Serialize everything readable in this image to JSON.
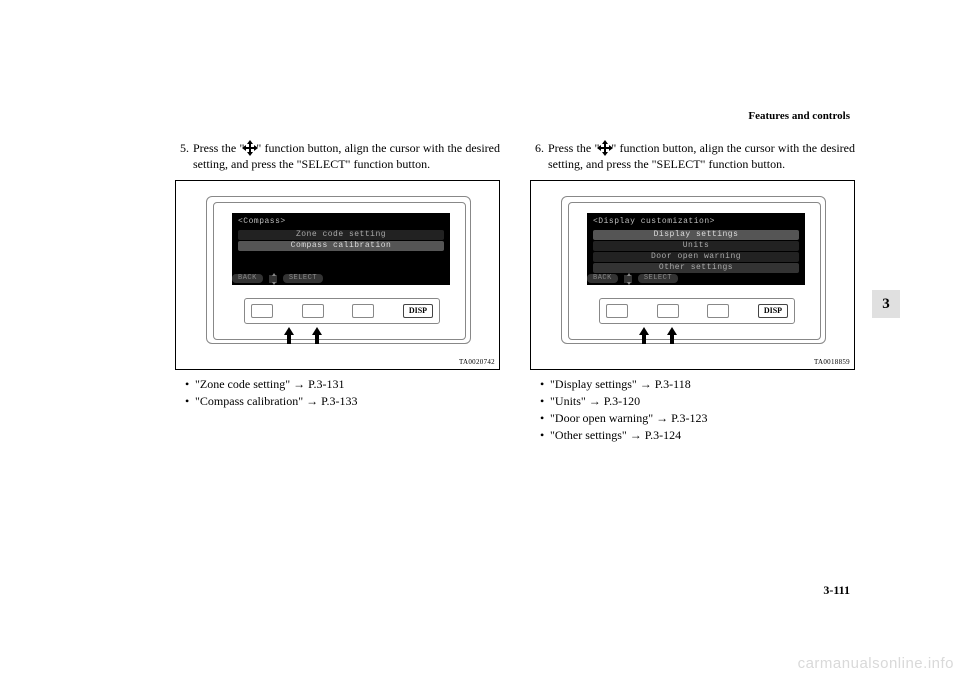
{
  "header": {
    "section_title": "Features and controls"
  },
  "left": {
    "step_num": "5.",
    "step_text_a": "Press the \"",
    "step_text_b": "\" function button, align the cursor with the desired setting, and press the \"SELECT\" function button.",
    "figure_code": "TA0020742",
    "screen": {
      "title": "<Compass>",
      "rows": [
        {
          "text": "Zone code setting",
          "style": "dim"
        },
        {
          "text": "Compass calibration",
          "style": "sel"
        }
      ],
      "fn_back": "BACK",
      "fn_select": "SELECT"
    },
    "disp_label": "DISP",
    "bullets": [
      "\"Zone code setting\" → P.3-131",
      "\"Compass calibration\" → P.3-133"
    ]
  },
  "right": {
    "step_num": "6.",
    "step_text_a": "Press the \"",
    "step_text_b": "\" function button, align the cursor with the desired setting, and press the \"SELECT\" function button.",
    "figure_code": "TA0018859",
    "screen": {
      "title": "<Display customization>",
      "rows": [
        {
          "text": "Display settings",
          "style": "sel"
        },
        {
          "text": "Units",
          "style": "dim"
        },
        {
          "text": "Door open warning",
          "style": "dim"
        },
        {
          "text": "Other settings",
          "style": "border"
        }
      ],
      "fn_back": "BACK",
      "fn_select": "SELECT"
    },
    "disp_label": "DISP",
    "bullets": [
      "\"Display settings\" → P.3-118",
      "\"Units\" → P.3-120",
      "\"Door open warning\" → P.3-123",
      "\"Other settings\" → P.3-124"
    ]
  },
  "side_tab": "3",
  "page_number": "3-111",
  "watermark": "carmanualsonline.info"
}
